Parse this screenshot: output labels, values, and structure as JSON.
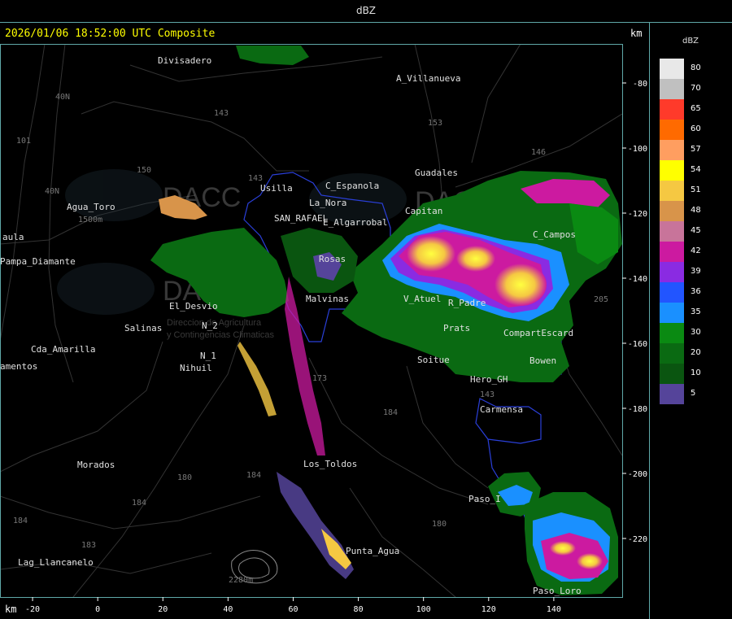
{
  "header": {
    "title": "dBZ",
    "subtitle": "2026/01/06 18:52:00 UTC Composite"
  },
  "axes": {
    "unit_label": "km",
    "x_ticks": [
      {
        "v": -20,
        "label": "-20"
      },
      {
        "v": 0,
        "label": "0"
      },
      {
        "v": 20,
        "label": "20"
      },
      {
        "v": 40,
        "label": "40"
      },
      {
        "v": 60,
        "label": "60"
      },
      {
        "v": 80,
        "label": "80"
      },
      {
        "v": 100,
        "label": "100"
      },
      {
        "v": 120,
        "label": "120"
      },
      {
        "v": 140,
        "label": "140"
      }
    ],
    "y_ticks": [
      {
        "v": -80,
        "label": "-80"
      },
      {
        "v": -100,
        "label": "-100"
      },
      {
        "v": -120,
        "label": "-120"
      },
      {
        "v": -140,
        "label": "-140"
      },
      {
        "v": -160,
        "label": "-160"
      },
      {
        "v": -180,
        "label": "-180"
      },
      {
        "v": -200,
        "label": "-200"
      },
      {
        "v": -220,
        "label": "-220"
      }
    ],
    "x_range": [
      -30,
      161
    ],
    "y_range": [
      -68,
      -238
    ]
  },
  "legend": {
    "title": "dBZ",
    "entries": [
      {
        "label": "80",
        "color": "#e8e8e8"
      },
      {
        "label": "70",
        "color": "#c0c0c0"
      },
      {
        "label": "65",
        "color": "#ff3a2a"
      },
      {
        "label": "60",
        "color": "#ff6a00"
      },
      {
        "label": "57",
        "color": "#ff9e60"
      },
      {
        "label": "54",
        "color": "#ffff00"
      },
      {
        "label": "51",
        "color": "#f5c842"
      },
      {
        "label": "48",
        "color": "#d8944a"
      },
      {
        "label": "45",
        "color": "#c8749a"
      },
      {
        "label": "42",
        "color": "#cc1aa0"
      },
      {
        "label": "39",
        "color": "#8a2be2"
      },
      {
        "label": "36",
        "color": "#2255ff"
      },
      {
        "label": "35",
        "color": "#1a90ff"
      },
      {
        "label": "30",
        "color": "#0a8a12"
      },
      {
        "label": "20",
        "color": "#0a6a12"
      },
      {
        "label": "10",
        "color": "#0a5510"
      },
      {
        "label": "5",
        "color": "#55449a"
      }
    ]
  },
  "places": [
    {
      "name": "Divisadero",
      "x": 194,
      "y": 78
    },
    {
      "name": "A_Villanueva",
      "x": 487,
      "y": 100
    },
    {
      "name": "Guadales",
      "x": 510,
      "y": 216
    },
    {
      "name": "Agua_Toro",
      "x": 82,
      "y": 258
    },
    {
      "name": "aula",
      "x": 3,
      "y": 295
    },
    {
      "name": "Pampa_Diamante",
      "x": 0,
      "y": 325
    },
    {
      "name": "El_Desvio",
      "x": 208,
      "y": 380
    },
    {
      "name": "Salinas",
      "x": 153,
      "y": 407
    },
    {
      "name": "Cda_Amarilla",
      "x": 38,
      "y": 433
    },
    {
      "name": "amentos",
      "x": 0,
      "y": 454
    },
    {
      "name": "Nihuil",
      "x": 221,
      "y": 456
    },
    {
      "name": "N_1",
      "x": 246,
      "y": 441
    },
    {
      "name": "N_2",
      "x": 248,
      "y": 404
    },
    {
      "name": "Usilla",
      "x": 320,
      "y": 235
    },
    {
      "name": "La_Nora",
      "x": 380,
      "y": 253
    },
    {
      "name": "C_Espanola",
      "x": 400,
      "y": 232
    },
    {
      "name": "SAN_RAFAEL",
      "x": 337,
      "y": 272
    },
    {
      "name": "E_Algarrobal",
      "x": 397,
      "y": 277
    },
    {
      "name": "Rosas",
      "x": 392,
      "y": 322
    },
    {
      "name": "Malvinas",
      "x": 376,
      "y": 371
    },
    {
      "name": "Capitan",
      "x": 498,
      "y": 263
    },
    {
      "name": "C_Campos",
      "x": 655,
      "y": 292
    },
    {
      "name": "V_Atuel",
      "x": 496,
      "y": 371
    },
    {
      "name": "R_Padre",
      "x": 551,
      "y": 376
    },
    {
      "name": "Prats",
      "x": 545,
      "y": 407
    },
    {
      "name": "CompartEscard",
      "x": 619,
      "y": 413
    },
    {
      "name": "Soitue",
      "x": 513,
      "y": 446
    },
    {
      "name": "Bowen",
      "x": 651,
      "y": 447
    },
    {
      "name": "Hero_GH",
      "x": 578,
      "y": 470
    },
    {
      "name": "Carmensa",
      "x": 590,
      "y": 507
    },
    {
      "name": "Morados",
      "x": 95,
      "y": 575
    },
    {
      "name": "Los_Toldos",
      "x": 373,
      "y": 574
    },
    {
      "name": "Paso_I",
      "x": 576,
      "y": 617
    },
    {
      "name": "Punta_Agua",
      "x": 425,
      "y": 681
    },
    {
      "name": "Lag_Llancanelo",
      "x": 22,
      "y": 695
    },
    {
      "name": "Paso_Loro",
      "x": 655,
      "y": 730
    }
  ],
  "route_labels": [
    {
      "name": "40N",
      "x": 68,
      "y": 122
    },
    {
      "name": "40N",
      "x": 55,
      "y": 238
    },
    {
      "name": "143",
      "x": 263,
      "y": 142
    },
    {
      "name": "153",
      "x": 526,
      "y": 154
    },
    {
      "name": "146",
      "x": 653,
      "y": 190
    },
    {
      "name": "101",
      "x": 20,
      "y": 176
    },
    {
      "name": "150",
      "x": 168,
      "y": 212
    },
    {
      "name": "143",
      "x": 305,
      "y": 222
    },
    {
      "name": "173",
      "x": 384,
      "y": 468
    },
    {
      "name": "184",
      "x": 471,
      "y": 510
    },
    {
      "name": "184",
      "x": 303,
      "y": 587
    },
    {
      "name": "180",
      "x": 218,
      "y": 590
    },
    {
      "name": "184",
      "x": 162,
      "y": 621
    },
    {
      "name": "184",
      "x": 16,
      "y": 643
    },
    {
      "name": "180",
      "x": 531,
      "y": 647
    },
    {
      "name": "183",
      "x": 100,
      "y": 673
    },
    {
      "name": "205",
      "x": 730,
      "y": 371
    },
    {
      "name": "143",
      "x": 590,
      "y": 488
    },
    {
      "name": "1500m",
      "x": 96,
      "y": 273
    },
    {
      "name": "2280m",
      "x": 281,
      "y": 716
    }
  ],
  "watermark": {
    "brand": "DACC",
    "line1": "Direccion de Agricultura",
    "line2": "y Contingencias Climaticas"
  }
}
